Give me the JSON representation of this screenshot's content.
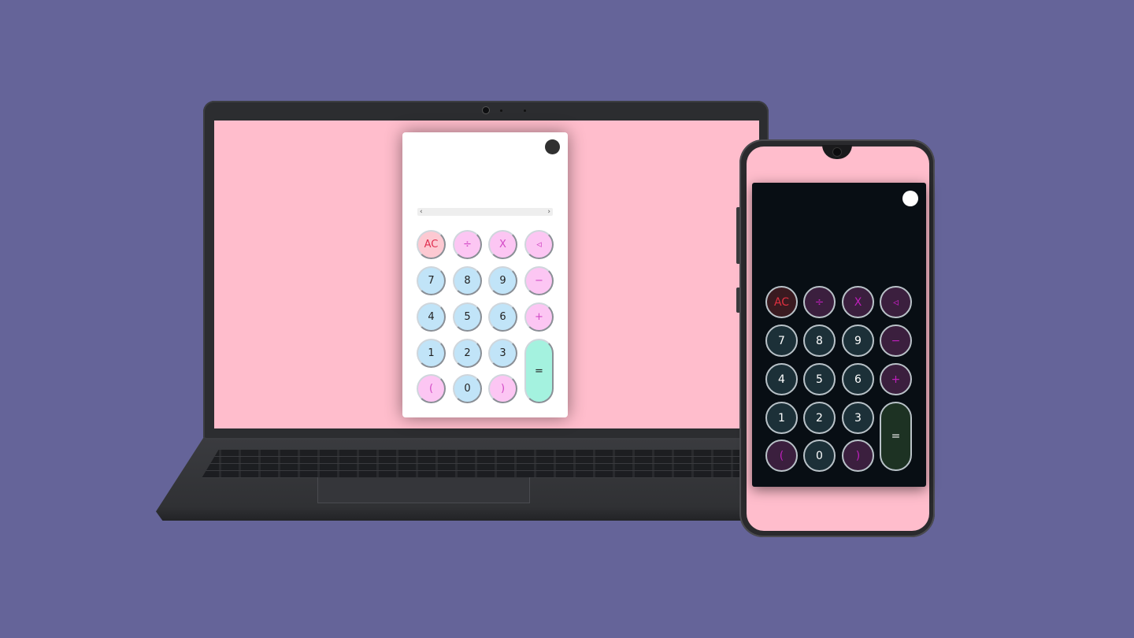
{
  "colors": {
    "background": "#656499",
    "screen_pink": "#ffbdcc",
    "desktop_calc_bg": "#ffffff",
    "mobile_calc_bg": "#080e14",
    "light_num": "#c1e4f8",
    "light_op": "#fcc6f3",
    "light_ac": "#fdc9d2",
    "light_eq": "#a4f2df",
    "dark_num": "#1c3038",
    "dark_op": "#3b1f3e",
    "dark_ac": "#3a1a20",
    "dark_eq": "#1d3223"
  },
  "desktop_calc": {
    "theme_toggle_icon": "dark-circle-toggle",
    "scroll_left": "‹",
    "scroll_right": "›",
    "keys": {
      "ac": "AC",
      "divide": "÷",
      "multiply": "X",
      "backspace": "◃",
      "seven": "7",
      "eight": "8",
      "nine": "9",
      "minus": "−",
      "four": "4",
      "five": "5",
      "six": "6",
      "plus": "+",
      "one": "1",
      "two": "2",
      "three": "3",
      "equals": "=",
      "open_paren": "(",
      "zero": "0",
      "close_paren": ")"
    }
  },
  "mobile_calc": {
    "theme_toggle_icon": "light-circle-toggle",
    "keys": {
      "ac": "AC",
      "divide": "÷",
      "multiply": "X",
      "backspace": "◃",
      "seven": "7",
      "eight": "8",
      "nine": "9",
      "minus": "−",
      "four": "4",
      "five": "5",
      "six": "6",
      "plus": "+",
      "one": "1",
      "two": "2",
      "three": "3",
      "equals": "=",
      "open_paren": "(",
      "zero": "0",
      "close_paren": ")"
    }
  }
}
